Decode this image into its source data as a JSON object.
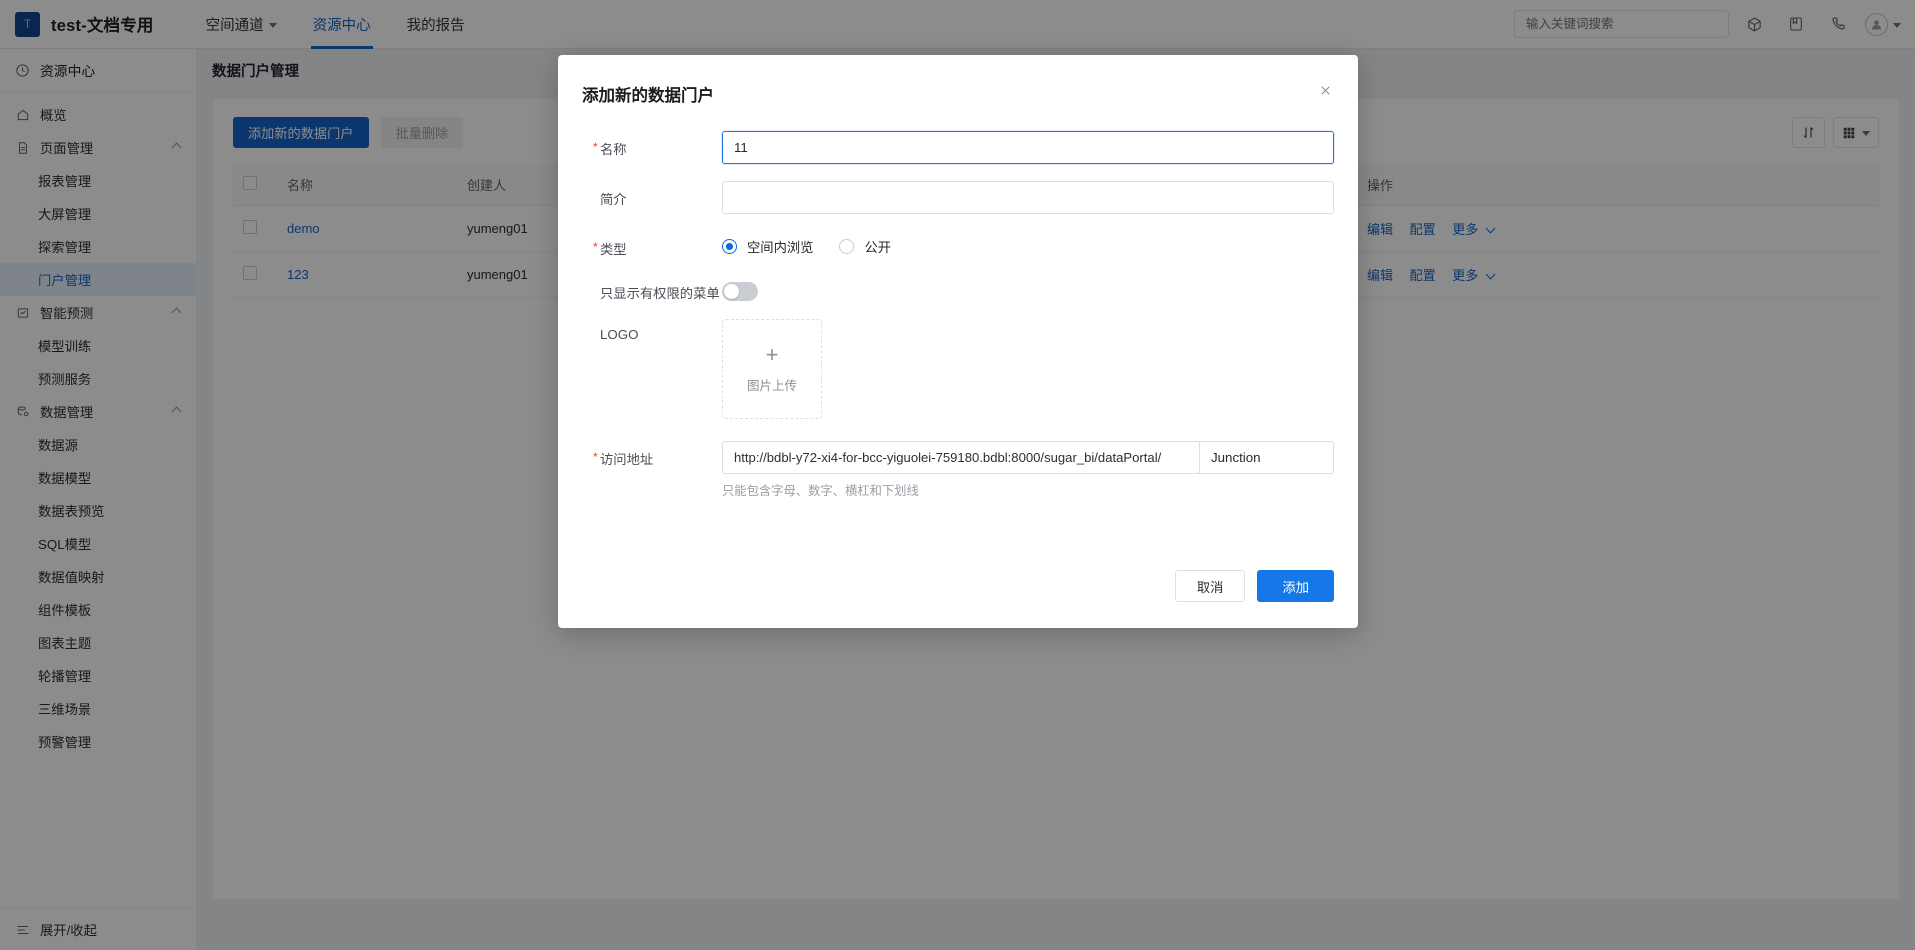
{
  "header": {
    "logo_letter": "T",
    "brand": "test-文档专用",
    "nav": [
      {
        "label": "空间通道",
        "has_caret": true,
        "active": false
      },
      {
        "label": "资源中心",
        "has_caret": false,
        "active": true
      },
      {
        "label": "我的报告",
        "has_caret": false,
        "active": false
      }
    ],
    "search_placeholder": "输入关键词搜索",
    "icons": [
      "cube-icon",
      "book-icon",
      "phone-icon",
      "avatar-icon",
      "chevron-down-icon"
    ]
  },
  "sidebar": {
    "title": "资源中心",
    "items": [
      {
        "label": "概览",
        "icon": "home-icon",
        "level": 0,
        "active": false,
        "expandable": false
      },
      {
        "label": "页面管理",
        "icon": "document-icon",
        "level": 0,
        "active": false,
        "expandable": true
      },
      {
        "label": "报表管理",
        "icon": "",
        "level": 1,
        "active": false,
        "expandable": false
      },
      {
        "label": "大屏管理",
        "icon": "",
        "level": 1,
        "active": false,
        "expandable": false
      },
      {
        "label": "探索管理",
        "icon": "",
        "level": 1,
        "active": false,
        "expandable": false
      },
      {
        "label": "门户管理",
        "icon": "",
        "level": 1,
        "active": true,
        "expandable": false
      },
      {
        "label": "智能预测",
        "icon": "chart-box-icon",
        "level": 0,
        "active": false,
        "expandable": true
      },
      {
        "label": "模型训练",
        "icon": "",
        "level": 1,
        "active": false,
        "expandable": false
      },
      {
        "label": "预测服务",
        "icon": "",
        "level": 1,
        "active": false,
        "expandable": false
      },
      {
        "label": "数据管理",
        "icon": "database-icon",
        "level": 0,
        "active": false,
        "expandable": true
      },
      {
        "label": "数据源",
        "icon": "",
        "level": 1,
        "active": false,
        "expandable": false
      },
      {
        "label": "数据模型",
        "icon": "",
        "level": 1,
        "active": false,
        "expandable": false
      },
      {
        "label": "数据表预览",
        "icon": "",
        "level": 1,
        "active": false,
        "expandable": false
      },
      {
        "label": "SQL模型",
        "icon": "",
        "level": 1,
        "active": false,
        "expandable": false
      },
      {
        "label": "数据值映射",
        "icon": "",
        "level": 1,
        "active": false,
        "expandable": false
      },
      {
        "label": "组件模板",
        "icon": "",
        "level": 1,
        "active": false,
        "expandable": false
      },
      {
        "label": "图表主题",
        "icon": "",
        "level": 1,
        "active": false,
        "expandable": false
      },
      {
        "label": "轮播管理",
        "icon": "",
        "level": 1,
        "active": false,
        "expandable": false
      },
      {
        "label": "三维场景",
        "icon": "",
        "level": 1,
        "active": false,
        "expandable": false
      },
      {
        "label": "预警管理",
        "icon": "",
        "level": 1,
        "active": false,
        "expandable": false
      }
    ],
    "collapse_label": "展开/收起"
  },
  "main": {
    "page_title": "数据门户管理",
    "toolbar": {
      "add_label": "添加新的数据门户",
      "batch_delete_label": "批量删除",
      "sort_icon": "sort-arrows-icon",
      "grid_icon": "grid-view-icon",
      "grid_caret": "chevron-down-icon"
    },
    "table": {
      "columns": [
        "名称",
        "创建人",
        "操作"
      ],
      "rows": [
        {
          "name": "demo",
          "creator": "yumeng01",
          "actions": [
            "编辑",
            "配置",
            "更多"
          ]
        },
        {
          "name": "123",
          "creator": "yumeng01",
          "actions": [
            "编辑",
            "配置",
            "更多"
          ]
        }
      ]
    }
  },
  "modal": {
    "title": "添加新的数据门户",
    "close_icon": "close-icon",
    "fields": {
      "name": {
        "label": "名称",
        "required": true,
        "value": "11",
        "placeholder": ""
      },
      "intro": {
        "label": "简介",
        "required": false,
        "value": "",
        "placeholder": ""
      },
      "type": {
        "label": "类型",
        "required": true,
        "options": [
          {
            "label": "空间内浏览",
            "selected": true
          },
          {
            "label": "公开",
            "selected": false
          }
        ]
      },
      "only_permitted_menu": {
        "label": "只显示有权限的菜单",
        "required": false,
        "on": false
      },
      "logo": {
        "label": "LOGO",
        "required": false,
        "upload_text": "图片上传",
        "plus_icon": "plus-icon"
      },
      "url": {
        "label": "访问地址",
        "required": true,
        "prefix": "http://bdbl-y72-xi4-for-bcc-yiguolei-759180.bdbl:8000/sugar_bi/dataPortal/",
        "suffix_value": "Junction",
        "hint": "只能包含字母、数字、横杠和下划线"
      }
    },
    "buttons": {
      "cancel": "取消",
      "confirm": "添加"
    }
  },
  "colors": {
    "accent": "#1677e8",
    "link": "#1964c0",
    "required": "#e8402a",
    "primary_button": "#1463c9"
  }
}
